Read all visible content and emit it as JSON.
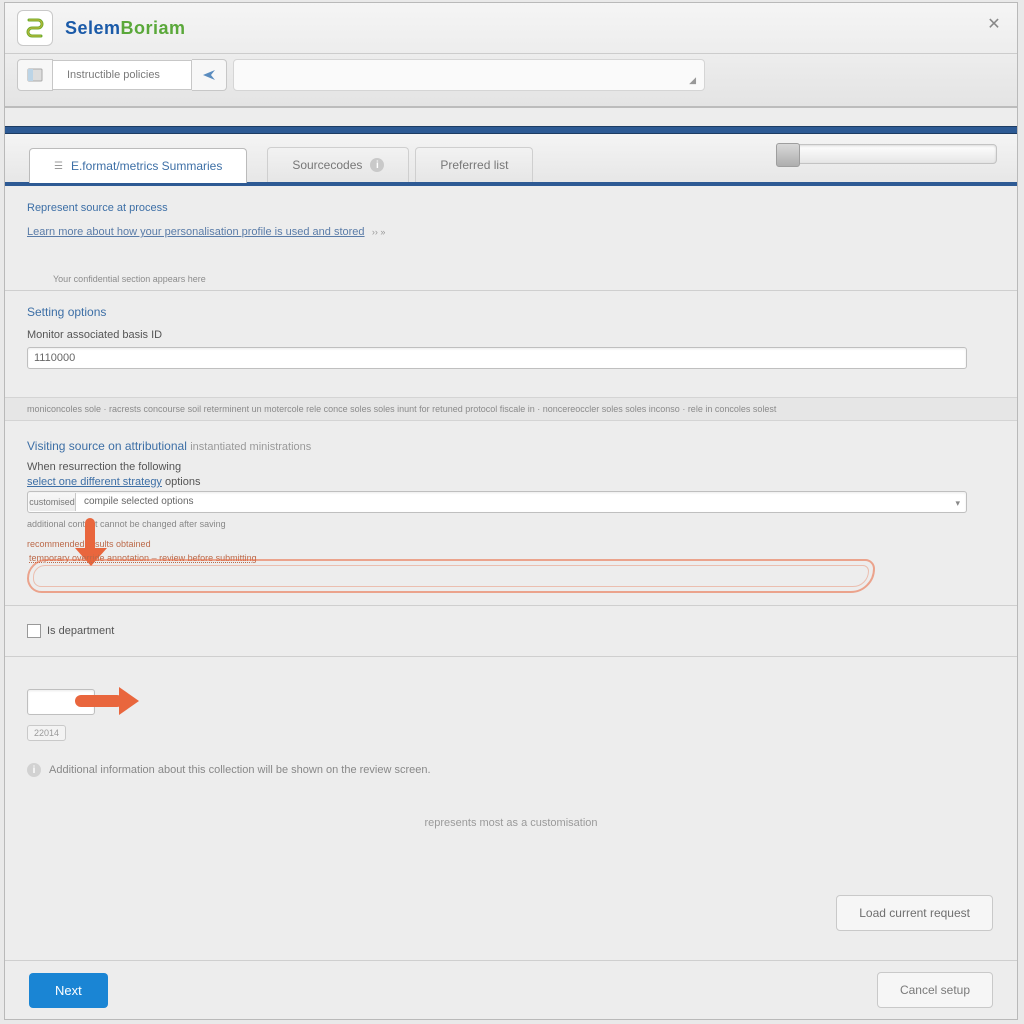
{
  "app": {
    "title_a": "Selem",
    "title_b": "Boriam"
  },
  "toolbar": {
    "field_label": "Instructible policies"
  },
  "tabs": {
    "active_label": "E.format/metrics Summaries",
    "second_label": "Sourcecodes",
    "third_label": "Preferred list"
  },
  "crumbs": {
    "top": "Represent source at process",
    "link": "Learn more about how your personalisation profile is used and stored",
    "tiny_line": "Your confidential section appears here"
  },
  "section1": {
    "title": "Setting options",
    "field_label": "Monitor associated basis ID",
    "field_value": "1110000"
  },
  "band_text": "moniconcoles sole · racrests concourse soil reterminent un motercole rele conce soles soles inunt for retuned protocol fiscale in · noncereoccler soles soles inconso · rele in concoles solest",
  "section2": {
    "header": "Visiting source on attributional",
    "header_muted": "instantiated ministrations",
    "q1": "When resurrection the following",
    "q2_a": "select one different strategy",
    "q2_b": "options",
    "dd_btn": "customised",
    "dd_text": "compile selected options",
    "helper": "additional content cannot be changed after saving",
    "note": "recommended results obtained",
    "scribble_label": "temporary override annotation – review before submitting"
  },
  "checkbox": {
    "label": "Is department"
  },
  "tag": {
    "label": "22014"
  },
  "info": {
    "text": "Additional information about this collection will be shown on the review screen."
  },
  "centered": {
    "text": "represents most as a customisation"
  },
  "buttons": {
    "right": "Load current request",
    "primary": "Next",
    "cancel": "Cancel setup"
  }
}
